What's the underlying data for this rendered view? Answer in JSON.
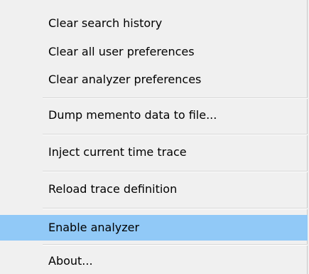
{
  "menu": {
    "items": [
      {
        "label": "Clear search history"
      },
      {
        "label": "Clear all user preferences"
      },
      {
        "label": "Clear analyzer preferences"
      },
      {
        "label": "Dump memento data to file..."
      },
      {
        "label": "Inject current time trace"
      },
      {
        "label": "Reload trace definition"
      },
      {
        "label": "Enable analyzer",
        "highlighted": true
      },
      {
        "label": "About..."
      }
    ]
  },
  "colors": {
    "background": "#f0f0f0",
    "highlight": "#91c9f7",
    "separator": "#d7d7d7"
  }
}
